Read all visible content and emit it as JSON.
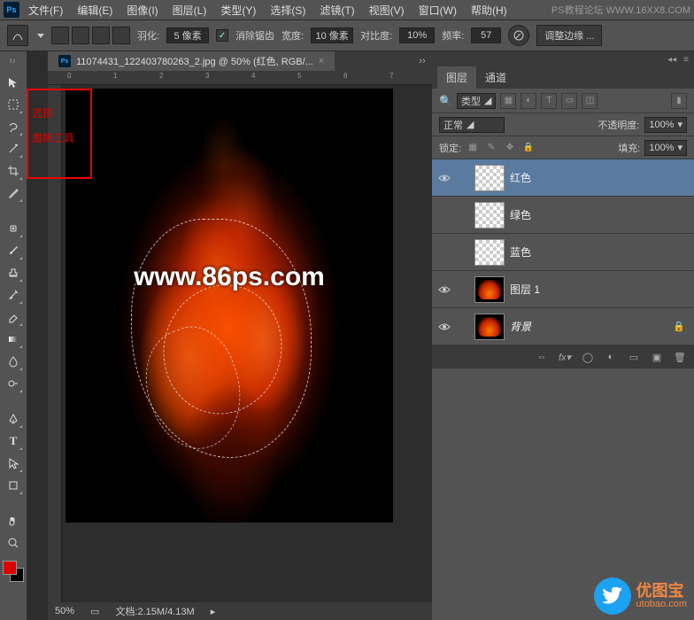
{
  "menus": [
    "文件(F)",
    "编辑(E)",
    "图像(I)",
    "图层(L)",
    "类型(Y)",
    "选择(S)",
    "滤镜(T)",
    "视图(V)",
    "窗口(W)",
    "帮助(H)"
  ],
  "menu_extra": "PS教程论坛 WWW.16XX8.COM",
  "options": {
    "feather_label": "羽化:",
    "feather_value": "5 像素",
    "antialias": "消除锯齿",
    "width_label": "宽度:",
    "width_value": "10 像素",
    "contrast_label": "对比度:",
    "contrast_value": "10%",
    "freq_label": "频率:",
    "freq_value": "57",
    "refine": "调整边缘 ..."
  },
  "doc": {
    "tab": "11074431_122403780263_2.jpg @ 50% (红色, RGB/...",
    "zoom": "50%",
    "status": "文档:2.15M/4.13M"
  },
  "watermark": "www.86ps.com",
  "redbox": {
    "l1": "选择",
    "l2": "魔棒工具"
  },
  "ruler_marks": [
    "0",
    "1",
    "2",
    "3",
    "4",
    "5",
    "6",
    "7"
  ],
  "layers_panel": {
    "tab1": "图层",
    "tab2": "通道",
    "kind": "类型",
    "blend": "正常",
    "opacity_label": "不透明度:",
    "opacity": "100%",
    "lock_label": "锁定:",
    "fill_label": "填充:",
    "fill": "100%",
    "layers": [
      {
        "name": "红色",
        "thumb": "checker",
        "sel": true,
        "vis": true
      },
      {
        "name": "绿色",
        "thumb": "checker",
        "sel": false,
        "vis": false
      },
      {
        "name": "蓝色",
        "thumb": "checker",
        "sel": false,
        "vis": false
      },
      {
        "name": "图层 1",
        "thumb": "fire",
        "sel": false,
        "vis": true
      },
      {
        "name": "背景",
        "thumb": "fire",
        "sel": false,
        "vis": true,
        "lock": true,
        "italic": true
      }
    ]
  },
  "utobao": {
    "name": "优图宝",
    "url": "utobao.com"
  }
}
